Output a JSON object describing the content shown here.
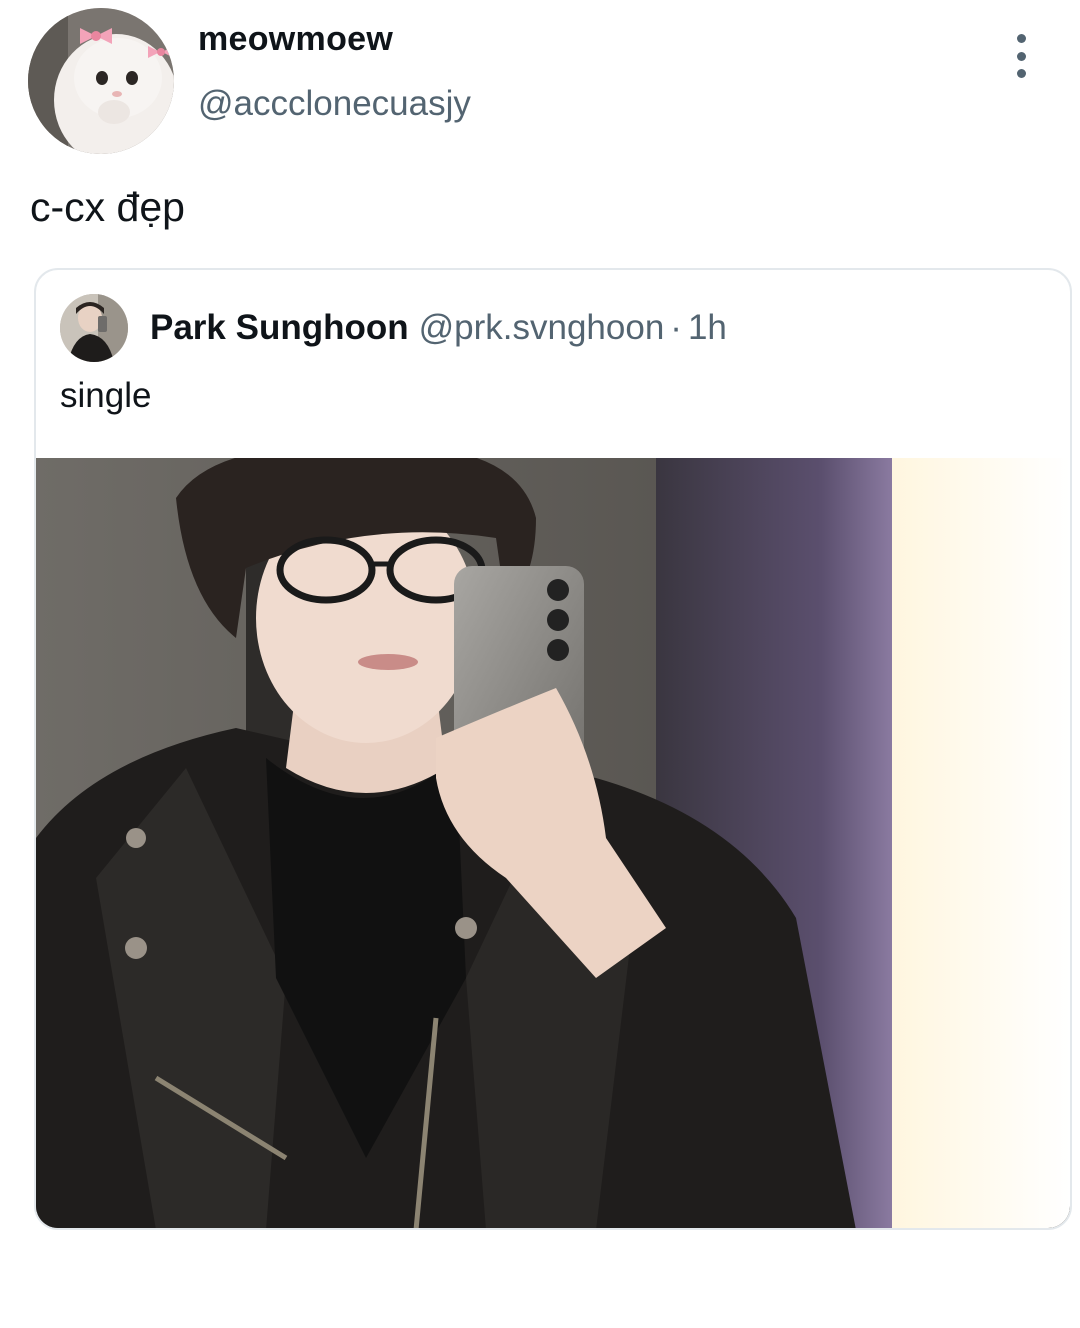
{
  "tweet": {
    "author": {
      "display_name": "meowmoew",
      "handle": "@accclonecuasjy"
    },
    "text": "c-cx đẹp",
    "quoted": {
      "author": {
        "display_name": "Park Sunghoon",
        "handle": "@prk.svnghoon"
      },
      "separator": "·",
      "time": "1h",
      "text": "single"
    }
  },
  "icons": {
    "more": "more-vertical-icon"
  },
  "colors": {
    "primary_text": "#0f1419",
    "secondary_text": "#536471",
    "border": "#e3e8ec"
  }
}
